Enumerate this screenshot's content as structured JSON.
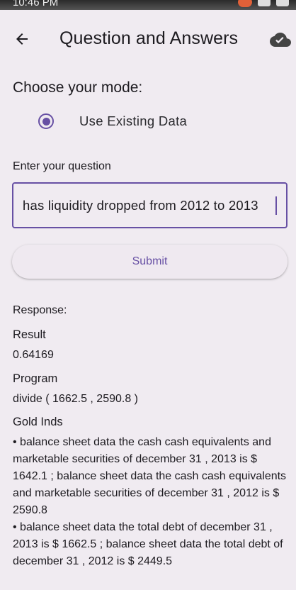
{
  "status_bar": {
    "time": "10:46 PM"
  },
  "app_bar": {
    "title": "Question and Answers",
    "back_icon": "arrow-left-icon",
    "action_icon": "cloud-done-icon"
  },
  "mode": {
    "heading": "Choose your mode:",
    "option_label": "Use Existing Data",
    "selected": true
  },
  "question": {
    "label": "Enter your question",
    "value": "has liquidity dropped from 2012 to 2013"
  },
  "submit": {
    "label": "Submit"
  },
  "response": {
    "heading": "Response:",
    "result_label": "Result",
    "result_value": "0.64169",
    "program_label": "Program",
    "program_value": "divide ( 1662.5 , 2590.8 )",
    "gold_label": "Gold Inds",
    "gold_items": [
      "• balance sheet data the cash cash equivalents and marketable securities of december 31 , 2013 is $ 1642.1 ; balance sheet data the cash cash equivalents and marketable securities of december 31 , 2012 is $ 2590.8",
      "• balance sheet data the total debt of december 31 , 2013 is $ 1662.5 ; balance sheet data the total debt of december 31 , 2012 is $ 2449.5"
    ]
  },
  "colors": {
    "accent": "#6750a4",
    "background": "#f0ebf1",
    "text": "#1d1b20"
  }
}
